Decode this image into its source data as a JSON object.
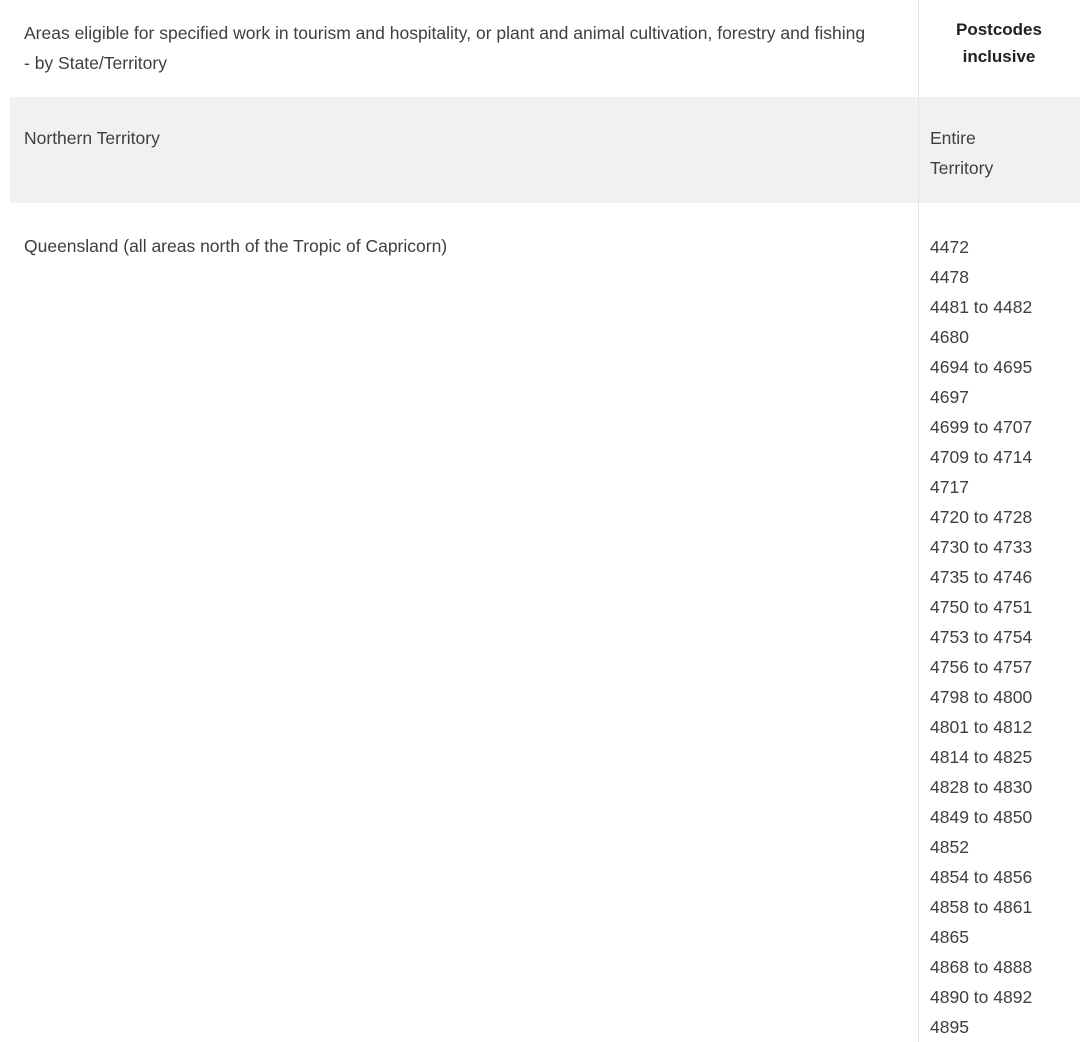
{
  "table": {
    "header": {
      "description": "Areas eligible for specified work in tourism and hospitality, or plant and animal cultivation, forestry and fishing -  by State/Territory",
      "postcodes_label_line1": "Postcodes",
      "postcodes_label_line2": "inclusive"
    },
    "rows": [
      {
        "state": "Northern Territory",
        "shaded": true,
        "postcodes": [
          "Entire",
          "Territory"
        ]
      },
      {
        "state": "Queensland (all areas north of the Tropic of Capricorn)",
        "shaded": false,
        "postcodes": [
          "4472",
          "4478",
          "4481 to 4482",
          "4680",
          "4694 to 4695",
          "4697",
          "4699 to 4707",
          "4709 to 4714",
          "4717",
          "4720 to 4728",
          "4730 to 4733",
          "4735 to 4746",
          "4750 to 4751",
          "4753 to 4754",
          "4756 to 4757",
          "4798 to 4800",
          "4801 to 4812",
          "4814 to 4825",
          "4828 to 4830",
          "4849 to 4850",
          "4852",
          "4854 to 4856",
          "4858 to 4861",
          "4865",
          "4868 to 4888",
          "4890 to 4892",
          "4895"
        ]
      }
    ]
  },
  "colors": {
    "text": "#3c4043",
    "header_text": "#202124",
    "shaded_row_background": "#f1f1f1",
    "divider": "#e4e4e4",
    "page_background": "#ffffff"
  }
}
